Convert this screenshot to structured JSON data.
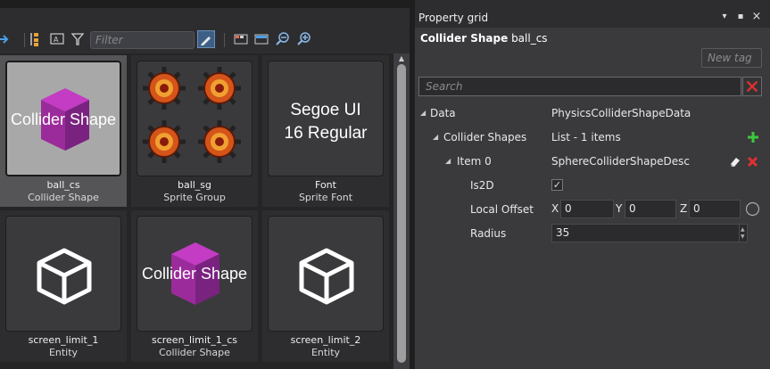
{
  "asset_view": {
    "close_glyph": "×",
    "filter_placeholder": "Filter",
    "assets": [
      {
        "name": "ball_cs",
        "type": "Collider Shape",
        "thumb": "collider",
        "thumb_text": "Collider Shape",
        "selected": true
      },
      {
        "name": "ball_sg",
        "type": "Sprite Group",
        "thumb": "sprites",
        "selected": false
      },
      {
        "name": "Font",
        "type": "Sprite Font",
        "thumb": "font",
        "thumb_text_line1": "Segoe UI",
        "thumb_text_line2": "16 Regular",
        "selected": false
      },
      {
        "name": "screen_limit_1",
        "type": "Entity",
        "thumb": "cube",
        "selected": false
      },
      {
        "name": "screen_limit_1_cs",
        "type": "Collider Shape",
        "thumb": "collider",
        "thumb_text": "Collider Shape",
        "selected": false
      },
      {
        "name": "screen_limit_2",
        "type": "Entity",
        "thumb": "cube",
        "selected": false
      }
    ]
  },
  "property_grid": {
    "title": "Property grid",
    "pin_glyph": "▾",
    "dock_glyph": "▪",
    "close_glyph": "×",
    "object_kind": "Collider Shape",
    "object_name": "ball_cs",
    "new_tag_placeholder": "New tag",
    "search_placeholder": "Search",
    "rows": {
      "data_label": "Data",
      "data_value": "PhysicsColliderShapeData",
      "collider_shapes_label": "Collider Shapes",
      "collider_shapes_value": "List - 1 items",
      "item0_label": "Item 0",
      "item0_value": "SphereColliderShapeDesc",
      "is2d_label": "Is2D",
      "is2d_checked": true,
      "is2d_glyph": "✓",
      "local_offset_label": "Local Offset",
      "offset_x_axis": "X",
      "offset_x": "0",
      "offset_y_axis": "Y",
      "offset_y": "0",
      "offset_z_axis": "Z",
      "offset_z": "0",
      "radius_label": "Radius",
      "radius_value": "35"
    },
    "colors": {
      "add": "#3cc83c",
      "remove": "#e03030",
      "panel": "#3a3a3d"
    }
  }
}
